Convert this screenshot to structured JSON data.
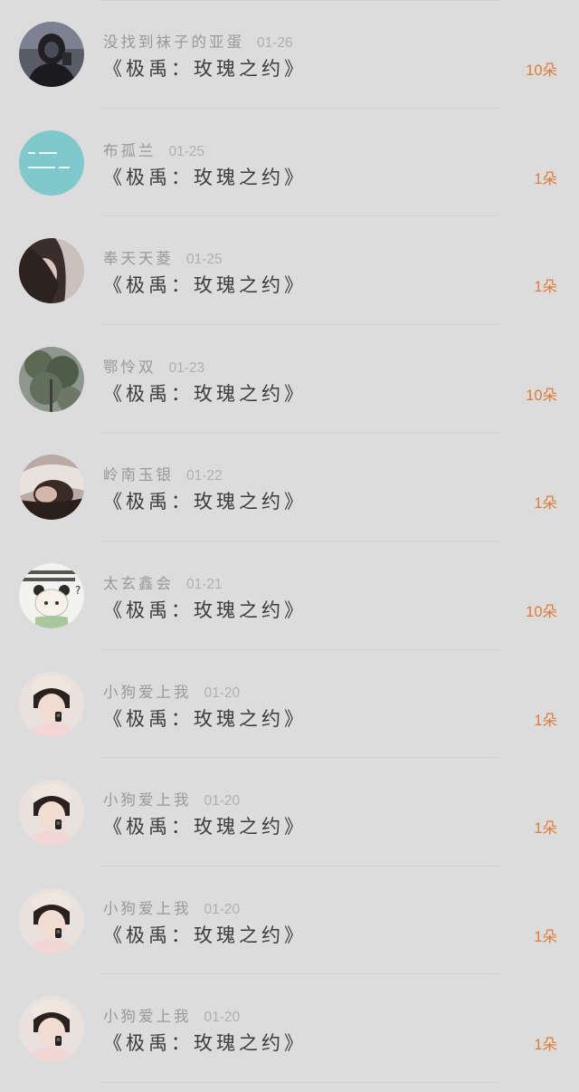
{
  "gift_records": [
    {
      "user": "没找到袜子的亚蛋",
      "date": "01-26",
      "gift": "《极禹：玫瑰之约》",
      "count": "10朵",
      "avatar": "dark-hooded-avatar"
    },
    {
      "user": "布孤兰",
      "date": "01-25",
      "gift": "《极禹：玫瑰之约》",
      "count": "1朵",
      "avatar": "teal-text-avatar"
    },
    {
      "user": "奉天天菱",
      "date": "01-25",
      "gift": "《极禹：玫瑰之约》",
      "count": "1朵",
      "avatar": "hair-portrait-avatar"
    },
    {
      "user": "鄂怜双",
      "date": "01-23",
      "gift": "《极禹：玫瑰之约》",
      "count": "10朵",
      "avatar": "tree-avatar"
    },
    {
      "user": "岭南玉银",
      "date": "01-22",
      "gift": "《极禹：玫瑰之约》",
      "count": "1朵",
      "avatar": "sleeping-girl-avatar"
    },
    {
      "user": "太玄鑫会",
      "date": "01-21",
      "gift": "《极禹：玫瑰之约》",
      "count": "10朵",
      "avatar": "panda-sticker-avatar"
    },
    {
      "user": "小狗爱上我",
      "date": "01-20",
      "gift": "《极禹：玫瑰之约》",
      "count": "1朵",
      "avatar": "girl-with-camera-avatar"
    },
    {
      "user": "小狗爱上我",
      "date": "01-20",
      "gift": "《极禹：玫瑰之约》",
      "count": "1朵",
      "avatar": "girl-with-camera-avatar"
    },
    {
      "user": "小狗爱上我",
      "date": "01-20",
      "gift": "《极禹：玫瑰之约》",
      "count": "1朵",
      "avatar": "girl-with-camera-avatar"
    },
    {
      "user": "小狗爱上我",
      "date": "01-20",
      "gift": "《极禹：玫瑰之约》",
      "count": "1朵",
      "avatar": "girl-with-camera-avatar"
    }
  ],
  "colors": {
    "background": "#dcdcdc",
    "count_accent": "#e07a35",
    "username": "#999999",
    "title": "#3c3c3c"
  }
}
